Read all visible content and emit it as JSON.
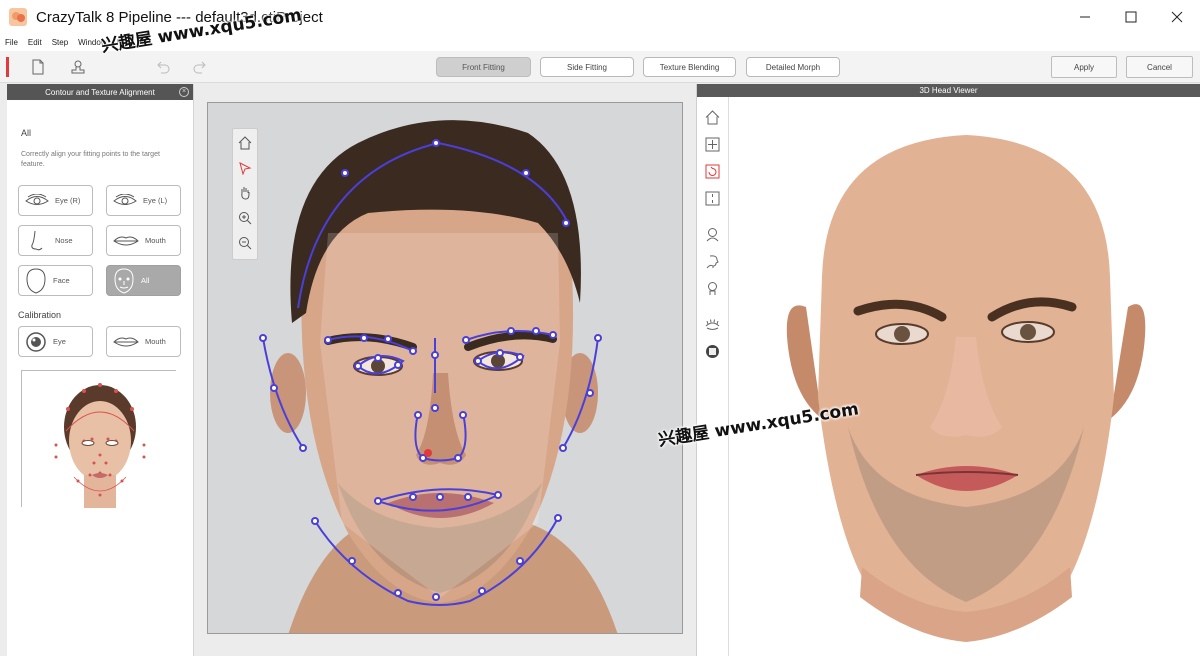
{
  "window": {
    "title": "CrazyTalk 8 Pipeline --- default3d.ctiProject",
    "app_icon": "crazytalk-logo-icon",
    "controls": [
      "minimize-icon",
      "maximize-icon",
      "close-icon"
    ]
  },
  "menu": [
    "File",
    "Edit",
    "Step",
    "Window",
    "Help"
  ],
  "toolbar": {
    "icons": [
      "new-file-icon",
      "stamp-icon",
      "undo-icon",
      "redo-icon"
    ],
    "steps": [
      {
        "label": "Front Fitting",
        "active": true
      },
      {
        "label": "Side Fitting",
        "active": false
      },
      {
        "label": "Texture Blending",
        "active": false
      },
      {
        "label": "Detailed Morph",
        "active": false
      }
    ],
    "apply_label": "Apply",
    "cancel_label": "Cancel"
  },
  "watermarks": [
    "兴趣屋 www.xqu5.com",
    "兴趣屋 www.xqu5.com"
  ],
  "left_panel": {
    "header": "Contour and Texture Alignment",
    "section_all": "All",
    "hint": "Correctly align your fitting points to the target feature.",
    "features": [
      {
        "label": "Eye (R)",
        "icon": "eye-icon",
        "active": false
      },
      {
        "label": "Eye (L)",
        "icon": "eye-icon",
        "active": false
      },
      {
        "label": "Nose",
        "icon": "nose-icon",
        "active": false
      },
      {
        "label": "Mouth",
        "icon": "mouth-icon",
        "active": false
      },
      {
        "label": "Face",
        "icon": "face-outline-icon",
        "active": false
      },
      {
        "label": "All",
        "icon": "face-all-icon",
        "active": true
      }
    ],
    "calibration_title": "Calibration",
    "calibration": [
      {
        "label": "Eye",
        "icon": "eye-calibration-icon"
      },
      {
        "label": "Mouth",
        "icon": "mouth-icon"
      }
    ]
  },
  "view_tools": [
    "home-icon",
    "select-arrow-icon",
    "pan-hand-icon",
    "zoom-in-icon",
    "zoom-out-icon"
  ],
  "right_panel": {
    "header": "3D Head Viewer",
    "tools": [
      "home-icon",
      "move-icon",
      "rotate-icon",
      "fit-icon",
      "head-front-icon",
      "head-side-icon",
      "head-back-icon",
      "eyelash-icon",
      "sphere-icon"
    ]
  },
  "colors": {
    "accent": "#e23a3a",
    "fitting_line": "#4a3fd8",
    "panel_header": "#555555",
    "active_button": "#a9a9a9"
  }
}
